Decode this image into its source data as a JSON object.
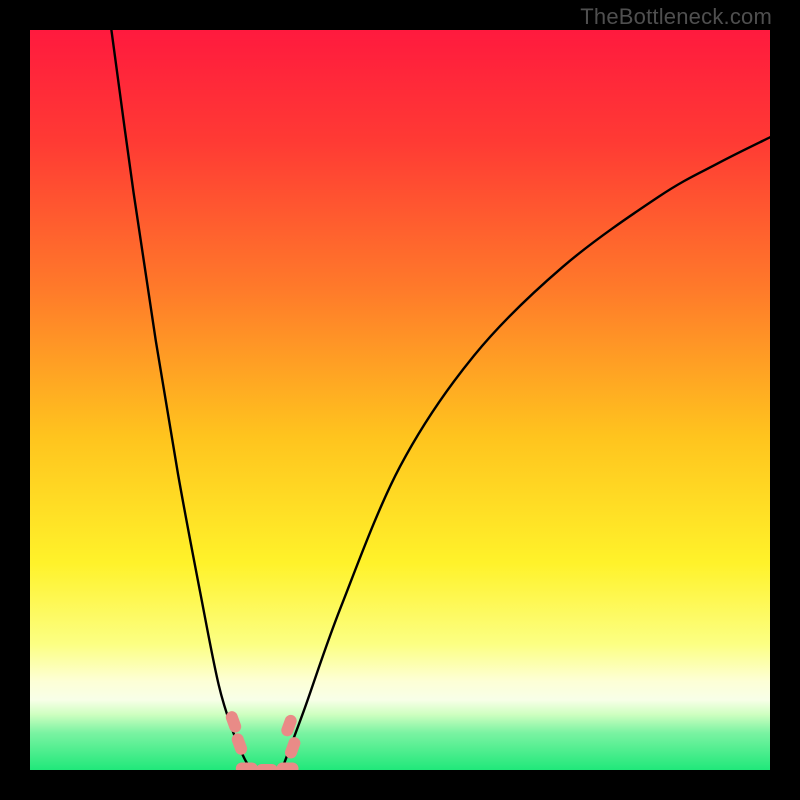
{
  "watermark": "TheBottleneck.com",
  "colors": {
    "bg_black": "#000000",
    "gradient_top": "#ff1a3e",
    "gradient_mid1": "#ff6a2a",
    "gradient_mid2": "#ffd21e",
    "gradient_mid3": "#fffb6e",
    "gradient_paleband": "#fdffd0",
    "gradient_bottom": "#20e87a",
    "curve_stroke": "#000000",
    "marker_fill": "#e98b87",
    "marker_stroke": "#b85a55"
  },
  "chart_data": {
    "type": "line",
    "title": "",
    "xlabel": "",
    "ylabel": "",
    "xlim": [
      0,
      1
    ],
    "ylim": [
      0,
      1
    ],
    "series": [
      {
        "name": "left-curve",
        "x": [
          0.11,
          0.14,
          0.17,
          0.2,
          0.23,
          0.255,
          0.275,
          0.29,
          0.3
        ],
        "y": [
          1.0,
          0.78,
          0.58,
          0.4,
          0.24,
          0.115,
          0.05,
          0.015,
          0.0
        ]
      },
      {
        "name": "right-curve",
        "x": [
          0.34,
          0.37,
          0.42,
          0.5,
          0.6,
          0.72,
          0.85,
          0.93,
          1.0
        ],
        "y": [
          0.0,
          0.08,
          0.22,
          0.41,
          0.56,
          0.68,
          0.775,
          0.82,
          0.855
        ]
      }
    ],
    "markers": [
      {
        "name": "left-pair-upper",
        "x": 0.275,
        "y": 0.065
      },
      {
        "name": "left-pair-lower",
        "x": 0.283,
        "y": 0.035
      },
      {
        "name": "right-pair-upper",
        "x": 0.35,
        "y": 0.06
      },
      {
        "name": "right-pair-lower",
        "x": 0.355,
        "y": 0.03
      },
      {
        "name": "bottom-left",
        "x": 0.293,
        "y": 0.002
      },
      {
        "name": "bottom-mid",
        "x": 0.32,
        "y": 0.0
      },
      {
        "name": "bottom-right",
        "x": 0.348,
        "y": 0.002
      }
    ],
    "gradient_stops": [
      {
        "offset": 0.0,
        "color": "#ff1a3e"
      },
      {
        "offset": 0.15,
        "color": "#ff3a34"
      },
      {
        "offset": 0.35,
        "color": "#ff7a2a"
      },
      {
        "offset": 0.55,
        "color": "#ffc41e"
      },
      {
        "offset": 0.72,
        "color": "#fff22a"
      },
      {
        "offset": 0.83,
        "color": "#fcff83"
      },
      {
        "offset": 0.88,
        "color": "#fdffd6"
      },
      {
        "offset": 0.905,
        "color": "#f8ffe8"
      },
      {
        "offset": 0.925,
        "color": "#ceffc0"
      },
      {
        "offset": 0.95,
        "color": "#7af3a2"
      },
      {
        "offset": 1.0,
        "color": "#20e87a"
      }
    ]
  }
}
